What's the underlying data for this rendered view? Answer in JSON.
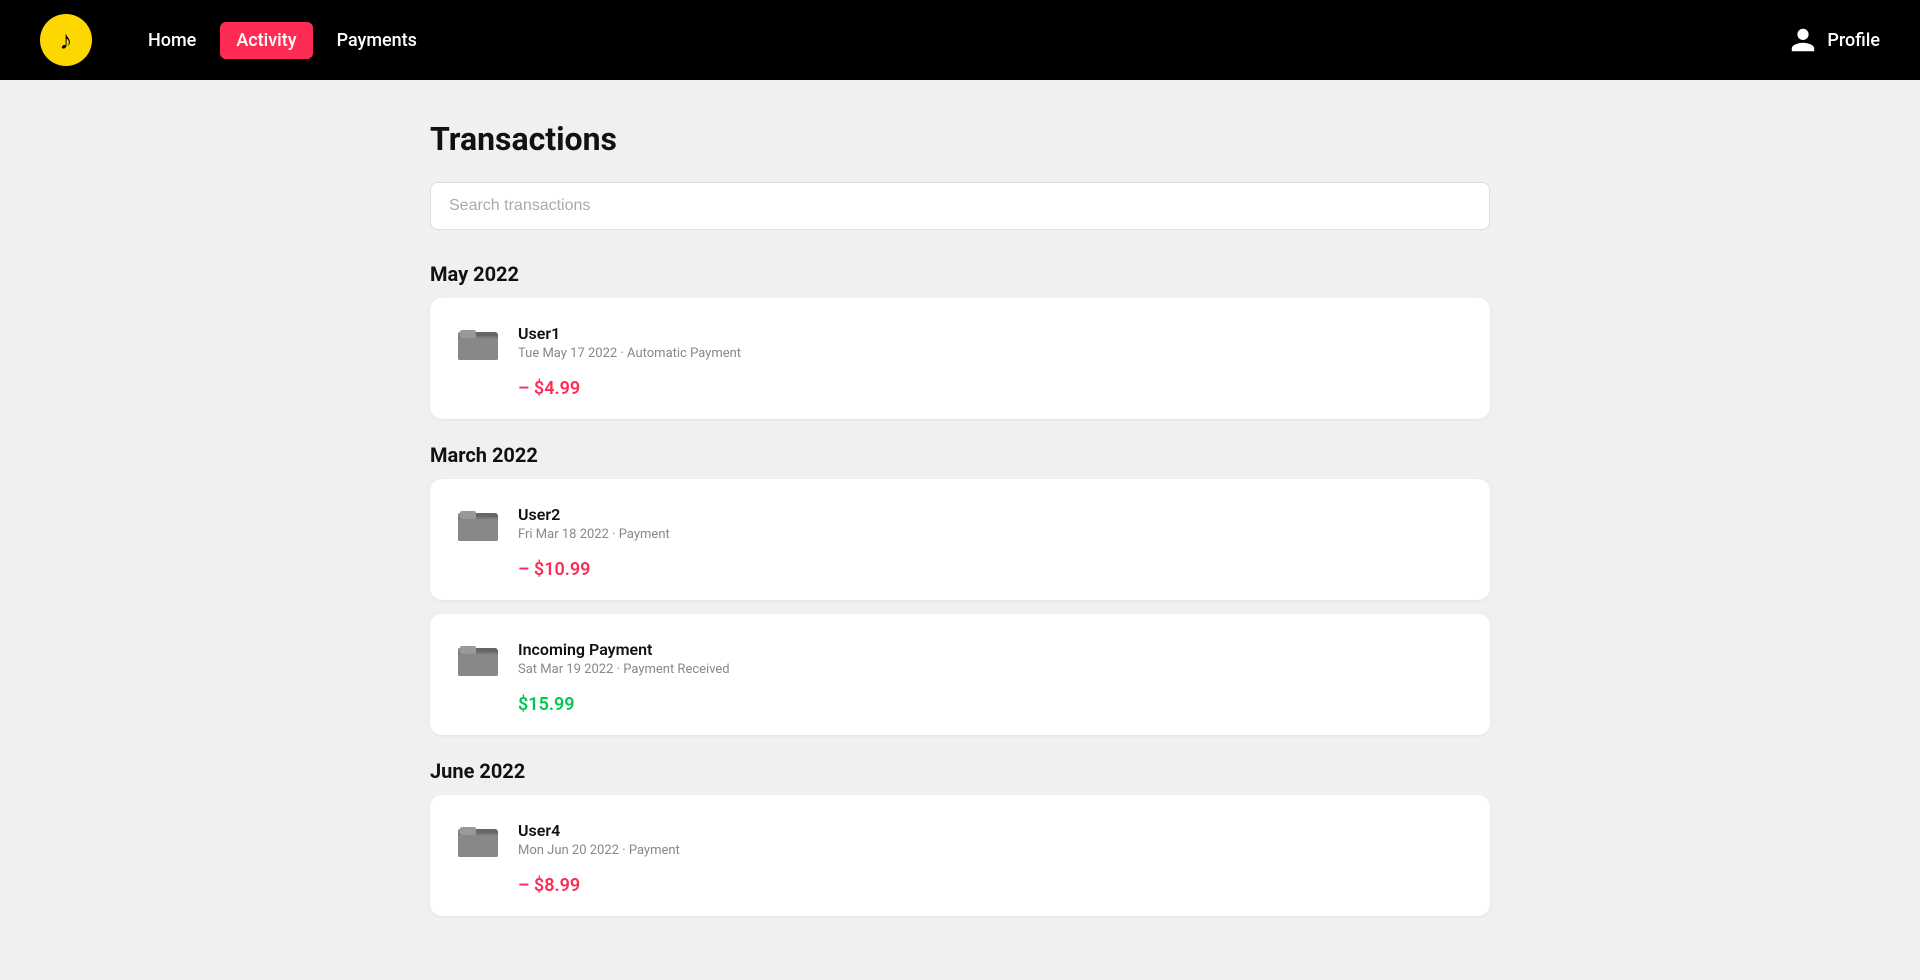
{
  "navbar": {
    "logo_alt": "TikTok Logo",
    "links": [
      {
        "id": "home",
        "label": "Home",
        "active": false
      },
      {
        "id": "activity",
        "label": "Activity",
        "active": true
      },
      {
        "id": "payments",
        "label": "Payments",
        "active": false
      }
    ],
    "profile_label": "Profile"
  },
  "page": {
    "title": "Transactions",
    "search_placeholder": "Search transactions"
  },
  "sections": [
    {
      "month": "May 2022",
      "transactions": [
        {
          "id": "t1",
          "name": "User1",
          "meta": "Tue May 17 2022 · Automatic Payment",
          "amount": "– $4.99",
          "type": "negative"
        }
      ]
    },
    {
      "month": "March 2022",
      "transactions": [
        {
          "id": "t2",
          "name": "User2",
          "meta": "Fri Mar 18 2022 · Payment",
          "amount": "– $10.99",
          "type": "negative"
        },
        {
          "id": "t3",
          "name": "Incoming Payment",
          "meta": "Sat Mar 19 2022 · Payment Received",
          "amount": "$15.99",
          "type": "positive"
        }
      ]
    },
    {
      "month": "June 2022",
      "transactions": [
        {
          "id": "t4",
          "name": "User4",
          "meta": "Mon Jun 20 2022 · Payment",
          "amount": "– $8.99",
          "type": "negative"
        }
      ]
    }
  ]
}
